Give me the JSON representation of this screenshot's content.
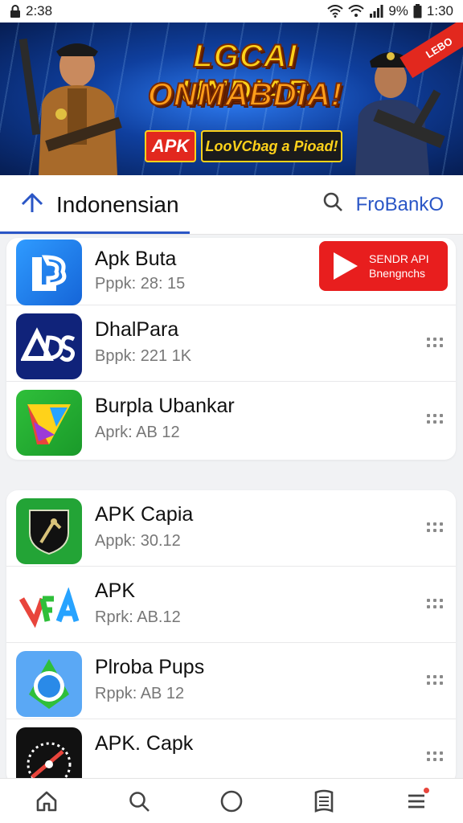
{
  "status_bar": {
    "time": "2:38",
    "battery_percent": "9%",
    "clock_right": "1:30",
    "icons": [
      "lock-icon",
      "wifi-icon",
      "signal-icon",
      "battery-icon"
    ]
  },
  "banner": {
    "title_line1": "LGCAI UNDIAR",
    "title_line2": "ONMABDIA!",
    "apk_badge": "APK",
    "subtitle": "LooVCbag a Pioad!",
    "corner_ribbon": "LEBO"
  },
  "tabs": {
    "active_label": "Indonensian",
    "search_label": "FroBankO"
  },
  "promo": {
    "line1": "SENDR API",
    "line2": "Bnengnchs"
  },
  "list1": [
    {
      "name": "Apk Buta",
      "meta": "Pppk: 28: 15",
      "icon": "app-icon-lb"
    },
    {
      "name": "DhalPara",
      "meta": "Bppk: 221 1K",
      "icon": "app-icon-ads"
    },
    {
      "name": "Burpla Ubankar",
      "meta": "Aprk: AB 12",
      "icon": "app-icon-triangle"
    }
  ],
  "list2": [
    {
      "name": "APK Capia",
      "meta": "Appk: 30.12",
      "icon": "app-icon-shield"
    },
    {
      "name": "APK",
      "meta": "Rprk: AB.12",
      "icon": "app-icon-apk-letters"
    },
    {
      "name": "Plroba Pups",
      "meta": "Rppk: AB 12",
      "icon": "app-icon-location"
    },
    {
      "name": "APK. Capk",
      "meta": "",
      "icon": "app-icon-speedometer"
    }
  ],
  "bottom_nav": [
    "home-icon",
    "search-icon",
    "circle-icon",
    "book-icon",
    "menu-icon"
  ],
  "colors": {
    "accent": "#2a56c6",
    "promo_red": "#e81e1e",
    "banner_blue": "#0f3f9e"
  }
}
